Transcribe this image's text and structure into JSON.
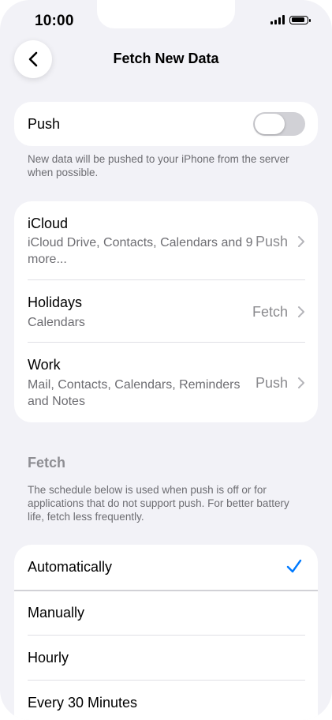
{
  "status_bar": {
    "time": "10:00"
  },
  "nav": {
    "title": "Fetch New Data"
  },
  "push": {
    "label": "Push",
    "enabled": false,
    "footnote": "New data will be pushed to your iPhone from the server when possible."
  },
  "accounts": [
    {
      "title": "iCloud",
      "subtitle": "iCloud Drive, Contacts, Calendars and 9 more...",
      "value": "Push"
    },
    {
      "title": "Holidays",
      "subtitle": "Calendars",
      "value": "Fetch"
    },
    {
      "title": "Work",
      "subtitle": "Mail, Contacts, Calendars, Reminders and Notes",
      "value": "Push"
    }
  ],
  "fetch": {
    "header": "Fetch",
    "footnote": "The schedule below is used when push is off or for applications that do not support push. For better battery life, fetch less frequently.",
    "options": [
      "Automatically",
      "Manually",
      "Hourly",
      "Every 30 Minutes"
    ],
    "selected": "Automatically"
  },
  "colors": {
    "accent": "#007aff",
    "background": "#f2f2f7",
    "secondary_text": "#6d6d72"
  }
}
